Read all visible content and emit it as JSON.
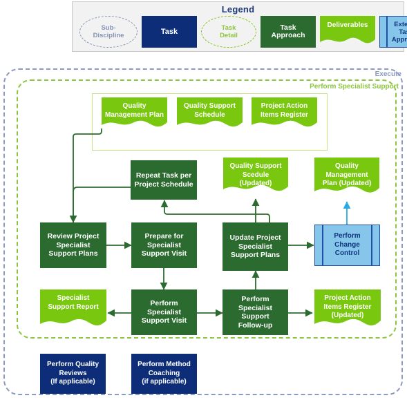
{
  "legend": {
    "title": "Legend",
    "items": [
      {
        "label": "Sub-\nDiscipline",
        "shape": "dashed-ellipse",
        "color": "#8494b4"
      },
      {
        "label": "Task",
        "shape": "rectangle",
        "color": "#0d2d79"
      },
      {
        "label": "Task\nDetail",
        "shape": "dashed-ellipse",
        "color": "#8cc63e"
      },
      {
        "label": "Task\nApproach",
        "shape": "rectangle",
        "color": "#2c6b2f"
      },
      {
        "label": "Deliverables",
        "shape": "wave-document",
        "color": "#7ac70f"
      },
      {
        "label": "External\nTask/\nApproach",
        "shape": "banded-rectangle",
        "color": "#85c6ea"
      }
    ]
  },
  "diagram": {
    "outer_phase_label": "Execute",
    "inner_process_label": "Perform Specialist Support",
    "deliverables_top": [
      {
        "label": "Quality\nManagement Plan"
      },
      {
        "label": "Quality Support\nSchedule"
      },
      {
        "label": "Project Action\nItems Register"
      }
    ],
    "nodes": {
      "repeat_task": "Repeat Task per\nProject Schedule",
      "quality_support_schedule_updated": "Quality Support\nScedule\n(Updated)",
      "quality_management_plan_updated": "Quality\nManagement\nPlan (Updated)",
      "review_project_plans": "Review Project\nSpecialist\nSupport Plans",
      "prepare_visit": "Prepare for\nSpecialist\nSupport Visit",
      "update_project_plans": "Update Project\nSpecialist\nSupport Plans",
      "perform_change_control": "Perform\nChange\nControl",
      "specialist_support_report": "Specialist\nSupport Report",
      "perform_visit": "Perform\nSpecialist\nSupport Visit",
      "perform_followup": "Perform\nSpecialist\nSupport\nFollow-up",
      "project_action_items_updated": "Project Action\nItems Register\n(Updated)",
      "perform_quality_reviews": "Perform Quality\nReviews\n(If applicable)",
      "perform_method_coaching": "Perform Method\nCoaching\n(if applicable)"
    }
  },
  "colors": {
    "deliverable_green": "#7ac70f",
    "approach_green": "#2c6b2f",
    "task_blue": "#0d2d79",
    "external_blue": "#85c6ea",
    "external_border": "#1f4fa8",
    "outer_dash": "#8b9ac0",
    "inner_dash": "#8cc63e",
    "arrow_green": "#2c6b2f",
    "arrow_blue": "#29abe2"
  }
}
